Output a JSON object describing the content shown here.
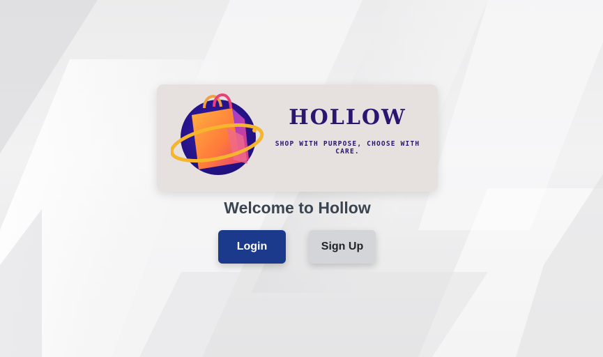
{
  "brand": {
    "name": "HOLLOW",
    "tagline": "SHOP WITH PURPOSE, CHOOSE WITH CARE."
  },
  "welcome_text": "Welcome to Hollow",
  "buttons": {
    "login_label": "Login",
    "signup_label": "Sign Up"
  },
  "colors": {
    "brand_text": "#2a1570",
    "login_button": "#1b3a8c",
    "signup_button": "#d4d5d9",
    "logo_card": "#e6e0df"
  },
  "icons": {
    "logo_mark": "shopping-bag-icon"
  }
}
